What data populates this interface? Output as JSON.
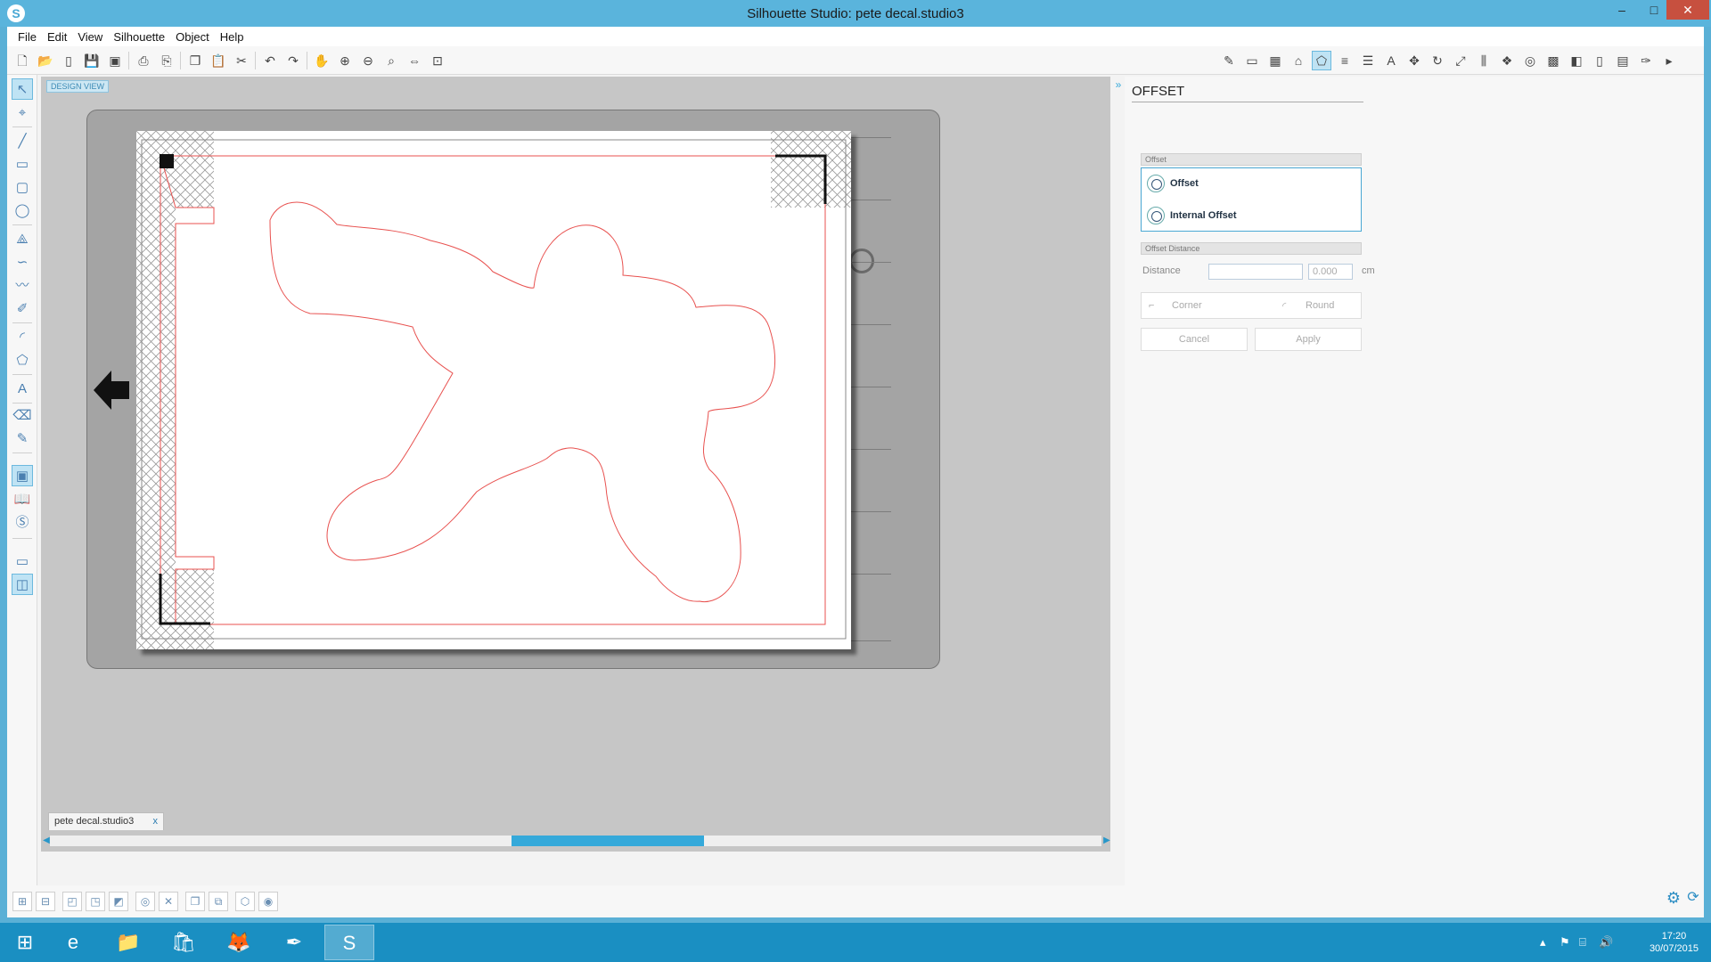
{
  "window": {
    "title": "Silhouette Studio: pete decal.studio3",
    "minimize_label": "–",
    "maximize_label": "□",
    "close_label": "✕"
  },
  "menu": [
    "File",
    "Edit",
    "View",
    "Silhouette",
    "Object",
    "Help"
  ],
  "canvas": {
    "design_view_label": "DESIGN VIEW",
    "document_tab": "pete decal.studio3",
    "tab_close": "x"
  },
  "panel": {
    "title": "OFFSET",
    "offset_section": "Offset",
    "options": [
      "Offset",
      "Internal Offset"
    ],
    "distance_section": "Offset Distance",
    "distance_label": "Distance",
    "distance_value": "0.000",
    "distance_unit": "cm",
    "corner_label": "Corner",
    "round_label": "Round",
    "cancel_label": "Cancel",
    "apply_label": "Apply"
  },
  "taskbar": {
    "time": "17:20",
    "date": "30/07/2015"
  },
  "colors": {
    "accent": "#35a9da",
    "titlebar": "#5ab4dc",
    "cut_line": "#e8514f",
    "taskbar": "#1a8fc2"
  }
}
